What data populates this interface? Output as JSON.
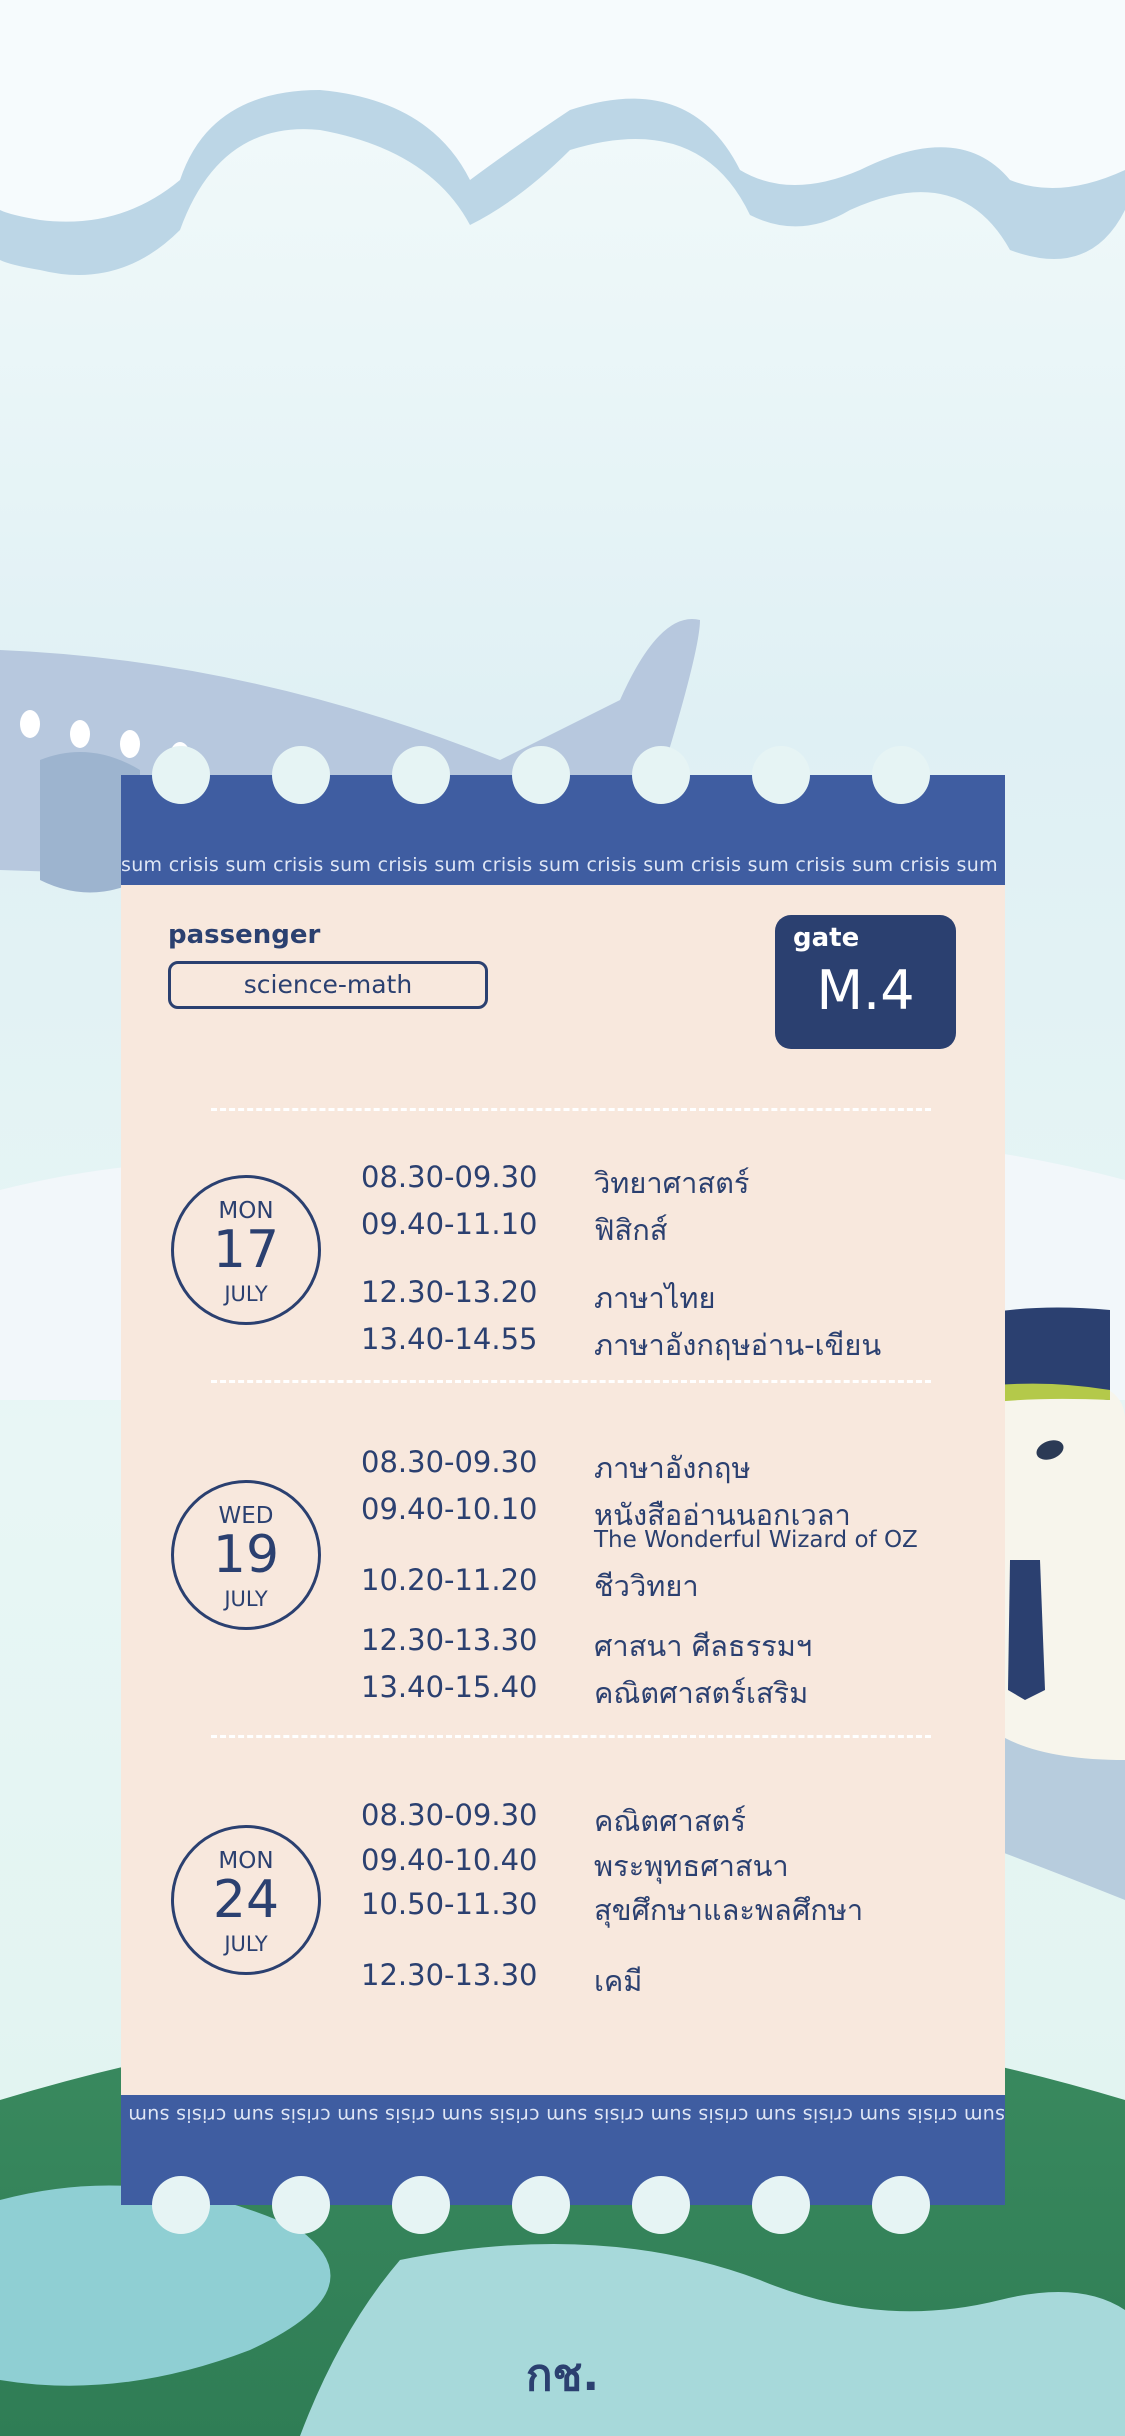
{
  "ticket": {
    "strip_text": "sum crisis sum crisis sum crisis sum crisis sum crisis sum crisis sum crisis sum crisis sum crisis sum",
    "passenger_label": "passenger",
    "passenger_value": "science-math",
    "gate_label": "gate",
    "gate_value": "M.4"
  },
  "days": [
    {
      "weekday": "MON",
      "date": "17",
      "month": "JULY",
      "slots": [
        {
          "time": "08.30-09.30",
          "subject": "วิทยาศาสตร์"
        },
        {
          "time": "09.40-11.10",
          "subject": "ฟิสิกส์"
        },
        {
          "time": "12.30-13.20",
          "subject": "ภาษาไทย"
        },
        {
          "time": "13.40-14.55",
          "subject": "ภาษาอังกฤษอ่าน-เขียน"
        }
      ]
    },
    {
      "weekday": "WED",
      "date": "19",
      "month": "JULY",
      "slots": [
        {
          "time": "08.30-09.30",
          "subject": "ภาษาอังกฤษ"
        },
        {
          "time": "09.40-10.10",
          "subject": "หนังสืออ่านนอกเวลา",
          "subtitle": "The Wonderful Wizard of OZ"
        },
        {
          "time": "10.20-11.20",
          "subject": "ชีววิทยา"
        },
        {
          "time": "12.30-13.30",
          "subject": "ศาสนา ศีลธรรมฯ"
        },
        {
          "time": "13.40-15.40",
          "subject": "คณิตศาสตร์เสริม"
        }
      ]
    },
    {
      "weekday": "MON",
      "date": "24",
      "month": "JULY",
      "slots": [
        {
          "time": "08.30-09.30",
          "subject": "คณิตศาสตร์"
        },
        {
          "time": "09.40-10.40",
          "subject": "พระพุทธศาสนา"
        },
        {
          "time": "10.50-11.30",
          "subject": "สุขศึกษาและพลศึกษา"
        },
        {
          "time": "12.30-13.30",
          "subject": "เคมี"
        }
      ]
    }
  ],
  "footer": {
    "logo_text": "กช."
  },
  "colors": {
    "navy": "#2b4070",
    "stub_blue": "#3f5da1",
    "ticket_bg": "#f8e8dd",
    "sky": "#d9eef2",
    "globe_green": "#3f8a63"
  }
}
